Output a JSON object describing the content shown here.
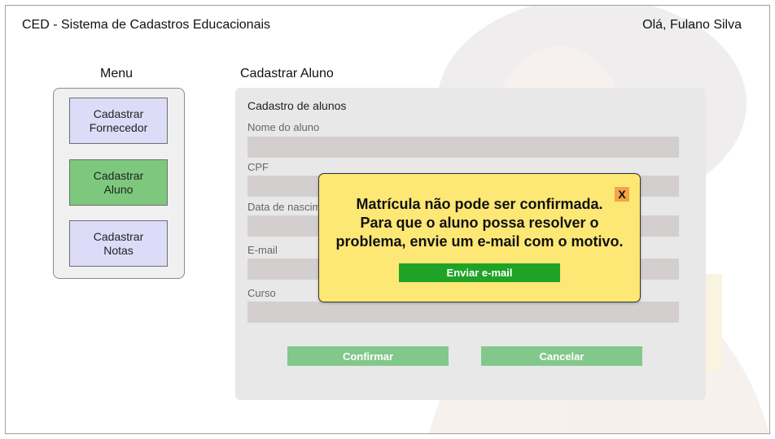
{
  "header": {
    "app_title": "CED - Sistema de Cadastros Educacionais",
    "greeting": "Olá, Fulano Silva"
  },
  "menu": {
    "title": "Menu",
    "items": [
      {
        "label": "Cadastrar\nFornecedor",
        "active": false
      },
      {
        "label": "Cadastrar\nAluno",
        "active": true
      },
      {
        "label": "Cadastrar\nNotas",
        "active": false
      }
    ]
  },
  "main": {
    "page_title": "Cadastrar Aluno",
    "form": {
      "heading": "Cadastro de alunos",
      "fields": [
        {
          "label": "Nome do aluno",
          "value": ""
        },
        {
          "label": "CPF",
          "value": ""
        },
        {
          "label": "Data de nascimento",
          "value": ""
        },
        {
          "label": "E-mail",
          "value": ""
        },
        {
          "label": "Curso",
          "value": ""
        }
      ],
      "confirm_label": "Confirmar",
      "cancel_label": "Cancelar"
    }
  },
  "dialog": {
    "message": "Matrícula não pode ser confirmada.\nPara que o aluno possa resolver o\nproblema, envie um e-mail com o motivo.",
    "close_label": "X",
    "action_label": "Enviar e-mail"
  },
  "colors": {
    "menu_button": "#dcdcf8",
    "menu_active": "#7dc87d",
    "dialog_bg": "#fde775",
    "dialog_close": "#f3a447",
    "dialog_action": "#1fa327",
    "form_buttons": "#82c88b"
  },
  "icons": {
    "close": "close-icon"
  }
}
